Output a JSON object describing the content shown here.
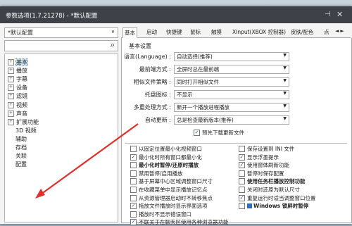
{
  "window": {
    "title": "参数选项(1.7.21278) - *默认配置",
    "pin_icon": "pin-icon",
    "close_icon": "close-icon"
  },
  "preset": {
    "value": "*默认配置"
  },
  "search": {
    "placeholder": ""
  },
  "tree": [
    {
      "label": "基本",
      "expander": "+",
      "selected": true
    },
    {
      "label": "播放",
      "expander": "+"
    },
    {
      "label": "字幕",
      "expander": "+"
    },
    {
      "label": "设备",
      "expander": "+"
    },
    {
      "label": "滤镜",
      "expander": "+"
    },
    {
      "label": "视频",
      "expander": "+"
    },
    {
      "label": "声音",
      "expander": "+"
    },
    {
      "label": "扩展功能",
      "expander": "+"
    },
    {
      "label": "3D 视频",
      "expander": ""
    },
    {
      "label": "辅助",
      "expander": ""
    },
    {
      "label": "存档",
      "expander": ""
    },
    {
      "label": "关联",
      "expander": ""
    },
    {
      "label": "配置",
      "expander": ""
    }
  ],
  "tabs": [
    "基本",
    "启动",
    "快捷键",
    "鼠标",
    "触摸",
    "XInput(XBOX 控制器)",
    "皮肤/配色",
    "点"
  ],
  "tab_nav": {
    "prev": "◄",
    "next": "►"
  },
  "panel": {
    "group_title": "基本设置",
    "fields": [
      {
        "label": "语言(Language) :",
        "value": "自动选择(推荐)"
      },
      {
        "label": "最前端方式 :",
        "value": "全屏时总在最前端"
      },
      {
        "label": "相似文件策略 :",
        "value": "同时打开相似文件"
      },
      {
        "label": "托盘图标 :",
        "value": "不显示"
      },
      {
        "label": "多重处理方式 :",
        "value": "新开一个播放进程播放"
      },
      {
        "label": "自动更新 :",
        "value": "总是检查最新版本(推荐)"
      }
    ],
    "preview_checkbox": {
      "label": "预先下载更新文件",
      "checked": true
    },
    "left_checks": [
      {
        "label": "以固定位置最小化视频窗口",
        "checked": false,
        "bold": false
      },
      {
        "label": "最小化时所有窗口都最小化",
        "checked": true,
        "bold": false
      },
      {
        "label": "最小化时暂停/还原时播放",
        "checked": false,
        "bold": true
      },
      {
        "label": "禁用暂停/启用播放",
        "checked": false,
        "bold": false
      },
      {
        "label": "基于屏幕中心区域调整窗口尺寸",
        "checked": false,
        "bold": false
      },
      {
        "label": "在收藏菜单中显示播放记忆点",
        "checked": false,
        "bold": false
      },
      {
        "label": "从资源管理器启动时不转移焦点",
        "checked": false,
        "bold": false
      },
      {
        "label": "拖放文件播放时显示界面选项",
        "checked": true,
        "bold": false
      },
      {
        "label": "播放时不显示错误窗口",
        "checked": false,
        "bold": false
      },
      {
        "label": "不联关于在聊天区使用各种浏览器功能",
        "checked": true,
        "bold": false
      }
    ],
    "right_checks": [
      {
        "label": "保存设置到 INI 文件",
        "checked": false,
        "bold": false
      },
      {
        "label": "显示浮墨提示",
        "checked": true,
        "bold": false
      },
      {
        "label": "使用窗体刷新功能",
        "checked": true,
        "bold": false
      },
      {
        "label": "暂停时保存配置",
        "checked": false,
        "bold": false
      },
      {
        "label": "使用任务栏播放控制功能",
        "checked": false,
        "bold": true
      },
      {
        "label": "关闭时还原为默认尺寸",
        "checked": false,
        "bold": false
      },
      {
        "label": "重复运行时适当调整窗口位置",
        "checked": true,
        "bold": false
      },
      {
        "label": "Windows 锁屏时暂停",
        "checked": false,
        "bold": true,
        "win_icon": true
      }
    ]
  },
  "colors": {
    "titlebar": "#3e4248",
    "annotation_arrow": "#e0302a",
    "selection": "#cfe3f7"
  }
}
